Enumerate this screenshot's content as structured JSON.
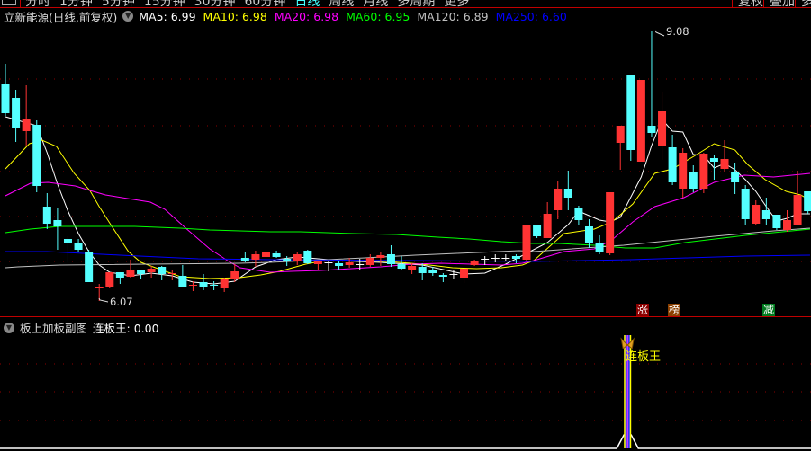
{
  "topbar": {
    "menu": [
      "分时",
      "1分钟",
      "5分钟",
      "15分钟",
      "30分钟",
      "60分钟",
      "日线",
      "周线",
      "月线",
      "多周期",
      "更多"
    ],
    "active": "日线",
    "right_buttons": [
      "复权",
      "叠加",
      "多"
    ]
  },
  "legend": {
    "title": "立新能源(日线,前复权)",
    "ma": [
      {
        "label": "MA5: 6.99",
        "color": "#ffffff"
      },
      {
        "label": "MA10: 6.98",
        "color": "#ffff00"
      },
      {
        "label": "MA20: 6.98",
        "color": "#ff00ff"
      },
      {
        "label": "MA60: 6.95",
        "color": "#00ff00"
      },
      {
        "label": "MA120: 6.89",
        "color": "#c0c0c0"
      },
      {
        "label": "MA250: 6.60",
        "color": "#0000ff"
      }
    ]
  },
  "annotations": {
    "high": "9.08",
    "low": "6.07"
  },
  "tags": [
    {
      "text": "涨",
      "color": "#8b0000"
    },
    {
      "text": "榜",
      "color": "#8b4000"
    },
    {
      "text": "减",
      "color": "#007a1f"
    }
  ],
  "sub": {
    "title": "板上加板副图",
    "indicator": "连板王: 0.00",
    "signal_label": "连板王"
  },
  "colors": {
    "up": "#ff3333",
    "down": "#54ffff",
    "grid": "#8b0000"
  },
  "chart_data": {
    "type": "candlestick",
    "ylim": [
      6.0,
      9.2
    ],
    "candles": [
      [
        8.49,
        8.16,
        8.71,
        8.13
      ],
      [
        8.33,
        7.99,
        8.42,
        7.84
      ],
      [
        7.96,
        8.09,
        8.47,
        7.79
      ],
      [
        8.03,
        7.35,
        8.08,
        7.28
      ],
      [
        7.12,
        6.93,
        7.27,
        6.87
      ],
      [
        6.97,
        6.9,
        7.1,
        6.64
      ],
      [
        6.76,
        6.71,
        6.79,
        6.5
      ],
      [
        6.71,
        6.64,
        6.76,
        6.61
      ],
      [
        6.61,
        6.28,
        6.64,
        6.28
      ],
      [
        6.21,
        6.23,
        6.26,
        6.07
      ],
      [
        6.23,
        6.39,
        6.39,
        6.21
      ],
      [
        6.39,
        6.33,
        6.39,
        6.26
      ],
      [
        6.34,
        6.42,
        6.53,
        6.33
      ],
      [
        6.41,
        6.37,
        6.41,
        6.31
      ],
      [
        6.39,
        6.43,
        6.46,
        6.33
      ],
      [
        6.45,
        6.37,
        6.46,
        6.3
      ],
      [
        6.37,
        6.38,
        6.42,
        6.3
      ],
      [
        6.35,
        6.23,
        6.47,
        6.22
      ],
      [
        6.24,
        6.25,
        6.29,
        6.18
      ],
      [
        6.28,
        6.22,
        6.37,
        6.19
      ],
      [
        6.25,
        6.24,
        6.29,
        6.19
      ],
      [
        6.21,
        6.31,
        6.33,
        6.17
      ],
      [
        6.31,
        6.4,
        6.48,
        6.28
      ],
      [
        6.55,
        6.51,
        6.61,
        6.5
      ],
      [
        6.53,
        6.59,
        6.63,
        6.45
      ],
      [
        6.56,
        6.62,
        6.66,
        6.54
      ],
      [
        6.6,
        6.56,
        6.63,
        6.55
      ],
      [
        6.54,
        6.51,
        6.57,
        6.46
      ],
      [
        6.52,
        6.59,
        6.61,
        6.47
      ],
      [
        6.63,
        6.49,
        6.64,
        6.48
      ],
      [
        6.48,
        6.51,
        6.52,
        6.42
      ],
      [
        6.5,
        6.5,
        6.52,
        6.4
      ],
      [
        6.49,
        6.46,
        6.51,
        6.42
      ],
      [
        6.47,
        6.5,
        6.55,
        6.44
      ],
      [
        6.48,
        6.48,
        6.54,
        6.42
      ],
      [
        6.47,
        6.55,
        6.59,
        6.45
      ],
      [
        6.55,
        6.58,
        6.62,
        6.46
      ],
      [
        6.59,
        6.48,
        6.69,
        6.45
      ],
      [
        6.48,
        6.43,
        6.57,
        6.41
      ],
      [
        6.41,
        6.46,
        6.49,
        6.37
      ],
      [
        6.45,
        6.38,
        6.49,
        6.3
      ],
      [
        6.42,
        6.38,
        6.45,
        6.35
      ],
      [
        6.36,
        6.34,
        6.38,
        6.28
      ],
      [
        6.37,
        6.37,
        6.42,
        6.31
      ],
      [
        6.33,
        6.43,
        6.45,
        6.27
      ],
      [
        6.47,
        6.51,
        6.53,
        6.46
      ],
      [
        6.54,
        6.54,
        6.57,
        6.47
      ],
      [
        6.55,
        6.55,
        6.59,
        6.5
      ],
      [
        6.55,
        6.55,
        6.59,
        6.51
      ],
      [
        6.57,
        6.54,
        6.59,
        6.49
      ],
      [
        6.53,
        6.91,
        6.92,
        6.52
      ],
      [
        6.91,
        6.79,
        6.92,
        6.77
      ],
      [
        6.77,
        7.04,
        7.17,
        6.77
      ],
      [
        7.08,
        7.32,
        7.4,
        6.98
      ],
      [
        7.32,
        7.22,
        7.52,
        7.08
      ],
      [
        7.11,
        6.97,
        7.13,
        6.92
      ],
      [
        6.9,
        6.72,
        6.98,
        6.66
      ],
      [
        6.71,
        6.61,
        6.8,
        6.59
      ],
      [
        6.6,
        7.28,
        7.28,
        6.58
      ],
      [
        7.83,
        8.02,
        8.02,
        7.53
      ],
      [
        8.58,
        7.75,
        8.58,
        7.63
      ],
      [
        7.62,
        8.53,
        8.53,
        7.62
      ],
      [
        8.02,
        7.94,
        9.08,
        7.9
      ],
      [
        7.79,
        8.18,
        8.4,
        7.64
      ],
      [
        7.78,
        7.39,
        7.92,
        7.36
      ],
      [
        7.32,
        7.72,
        7.77,
        7.22
      ],
      [
        7.51,
        7.32,
        7.58,
        7.28
      ],
      [
        7.32,
        7.71,
        7.72,
        7.27
      ],
      [
        7.66,
        7.62,
        7.69,
        7.42
      ],
      [
        7.54,
        7.65,
        7.86,
        7.5
      ],
      [
        7.5,
        7.39,
        7.61,
        7.26
      ],
      [
        7.32,
        6.98,
        7.36,
        6.91
      ],
      [
        6.93,
        7.14,
        7.19,
        6.92
      ],
      [
        7.08,
        6.98,
        7.22,
        6.92
      ],
      [
        7.03,
        6.88,
        7.03,
        6.86
      ],
      [
        6.86,
        6.97,
        7.08,
        6.84
      ],
      [
        6.92,
        7.25,
        7.52,
        6.92
      ],
      [
        7.29,
        7.07,
        7.29,
        7.04
      ]
    ],
    "ma_lines": [
      {
        "name": "MA5",
        "color": "#ffffff",
        "points": [
          [
            0,
            8.12
          ],
          [
            3,
            8.02
          ],
          [
            4,
            7.72
          ],
          [
            5,
            7.37
          ],
          [
            6,
            7.07
          ],
          [
            7,
            6.82
          ],
          [
            8,
            6.62
          ],
          [
            9,
            6.47
          ],
          [
            10,
            6.39
          ],
          [
            12,
            6.35
          ],
          [
            14,
            6.38
          ],
          [
            16,
            6.35
          ],
          [
            18,
            6.28
          ],
          [
            20,
            6.26
          ],
          [
            22,
            6.29
          ],
          [
            24,
            6.45
          ],
          [
            26,
            6.53
          ],
          [
            28,
            6.56
          ],
          [
            32,
            6.52
          ],
          [
            36,
            6.5
          ],
          [
            40,
            6.47
          ],
          [
            44,
            6.37
          ],
          [
            46,
            6.38
          ],
          [
            48,
            6.48
          ],
          [
            50,
            6.6
          ],
          [
            52,
            6.72
          ],
          [
            54,
            6.92
          ],
          [
            55,
            7.07
          ],
          [
            57,
            6.97
          ],
          [
            58,
            6.95
          ],
          [
            59,
            7.0
          ],
          [
            61,
            7.45
          ],
          [
            62,
            7.8
          ],
          [
            63,
            8.09
          ],
          [
            64,
            7.96
          ],
          [
            65,
            7.95
          ],
          [
            66,
            7.7
          ],
          [
            67,
            7.69
          ],
          [
            68,
            7.55
          ],
          [
            69,
            7.6
          ],
          [
            70,
            7.53
          ],
          [
            71,
            7.42
          ],
          [
            72,
            7.29
          ],
          [
            73,
            7.12
          ],
          [
            74,
            6.96
          ],
          [
            75,
            6.99
          ],
          [
            76,
            7.04
          ],
          [
            77.2,
            7.04
          ]
        ]
      },
      {
        "name": "MA10",
        "color": "#ffff00",
        "points": [
          [
            0,
            7.54
          ],
          [
            2.3,
            7.82
          ],
          [
            3.5,
            7.86
          ],
          [
            4.9,
            7.79
          ],
          [
            6.6,
            7.49
          ],
          [
            8.1,
            7.3
          ],
          [
            9,
            7.12
          ],
          [
            10.1,
            6.92
          ],
          [
            11.8,
            6.62
          ],
          [
            13,
            6.5
          ],
          [
            14.4,
            6.44
          ],
          [
            16.8,
            6.34
          ],
          [
            19.6,
            6.32
          ],
          [
            22.5,
            6.33
          ],
          [
            24.5,
            6.36
          ],
          [
            26.3,
            6.4
          ],
          [
            28.8,
            6.48
          ],
          [
            30.6,
            6.52
          ],
          [
            33.2,
            6.52
          ],
          [
            36.6,
            6.51
          ],
          [
            38.9,
            6.49
          ],
          [
            40.7,
            6.47
          ],
          [
            42.9,
            6.44
          ],
          [
            45.2,
            6.43
          ],
          [
            47.6,
            6.44
          ],
          [
            49.6,
            6.47
          ],
          [
            50.7,
            6.52
          ],
          [
            53.6,
            6.82
          ],
          [
            56.5,
            6.87
          ],
          [
            58.2,
            6.95
          ],
          [
            60.2,
            7.15
          ],
          [
            62.3,
            7.49
          ],
          [
            64,
            7.54
          ],
          [
            66.2,
            7.69
          ],
          [
            68,
            7.82
          ],
          [
            70,
            7.75
          ],
          [
            71.2,
            7.59
          ],
          [
            72.9,
            7.42
          ],
          [
            74.9,
            7.29
          ],
          [
            76.3,
            7.25
          ],
          [
            77.2,
            7.19
          ]
        ]
      },
      {
        "name": "MA20",
        "color": "#ff00ff",
        "points": [
          [
            0,
            7.24
          ],
          [
            2.4,
            7.38
          ],
          [
            4.1,
            7.39
          ],
          [
            6.7,
            7.35
          ],
          [
            8.1,
            7.3
          ],
          [
            9.6,
            7.25
          ],
          [
            13.9,
            7.17
          ],
          [
            15.3,
            7.09
          ],
          [
            17.4,
            6.87
          ],
          [
            19.6,
            6.65
          ],
          [
            21.3,
            6.52
          ],
          [
            22.5,
            6.44
          ],
          [
            25.4,
            6.39
          ],
          [
            27.4,
            6.4
          ],
          [
            30.3,
            6.41
          ],
          [
            33.2,
            6.43
          ],
          [
            36,
            6.45
          ],
          [
            39,
            6.48
          ],
          [
            41.8,
            6.49
          ],
          [
            44.7,
            6.48
          ],
          [
            47.6,
            6.47
          ],
          [
            49.6,
            6.49
          ],
          [
            50.7,
            6.52
          ],
          [
            53.6,
            6.62
          ],
          [
            56.5,
            6.65
          ],
          [
            58.2,
            6.75
          ],
          [
            60.2,
            6.95
          ],
          [
            62.3,
            7.12
          ],
          [
            65.1,
            7.22
          ],
          [
            68,
            7.39
          ],
          [
            70.9,
            7.47
          ],
          [
            73.7,
            7.45
          ],
          [
            77.2,
            7.49
          ]
        ]
      },
      {
        "name": "MA60",
        "color": "#00ff00",
        "points": [
          [
            0,
            6.83
          ],
          [
            2.4,
            6.87
          ],
          [
            5.2,
            6.9
          ],
          [
            12.4,
            6.9
          ],
          [
            16.8,
            6.88
          ],
          [
            19.6,
            6.86
          ],
          [
            25.4,
            6.84
          ],
          [
            28.3,
            6.84
          ],
          [
            33.5,
            6.82
          ],
          [
            37.5,
            6.81
          ],
          [
            41.5,
            6.78
          ],
          [
            44.5,
            6.76
          ],
          [
            47.6,
            6.73
          ],
          [
            50.5,
            6.71
          ],
          [
            53.1,
            6.71
          ],
          [
            56.5,
            6.69
          ],
          [
            59.5,
            6.66
          ],
          [
            62.3,
            6.66
          ],
          [
            65.2,
            6.72
          ],
          [
            71,
            6.8
          ],
          [
            77.2,
            6.87
          ]
        ]
      },
      {
        "name": "MA120",
        "color": "#c0c0c0",
        "points": [
          [
            0,
            6.44
          ],
          [
            1.2,
            6.45
          ],
          [
            5.2,
            6.47
          ],
          [
            22.5,
            6.49
          ],
          [
            25.4,
            6.5
          ],
          [
            34.5,
            6.55
          ],
          [
            39.3,
            6.58
          ],
          [
            43.3,
            6.6
          ],
          [
            49.3,
            6.63
          ],
          [
            50.7,
            6.62
          ],
          [
            59.3,
            6.69
          ],
          [
            68,
            6.79
          ],
          [
            73.7,
            6.85
          ],
          [
            77.2,
            6.88
          ]
        ]
      },
      {
        "name": "MA250",
        "color": "#0000ff",
        "points": [
          [
            0,
            6.62
          ],
          [
            4,
            6.62
          ],
          [
            11,
            6.58
          ],
          [
            18.5,
            6.54
          ],
          [
            25.4,
            6.53
          ],
          [
            50.7,
            6.51
          ],
          [
            60,
            6.53
          ],
          [
            65.5,
            6.55
          ],
          [
            71,
            6.57
          ],
          [
            77.2,
            6.58
          ]
        ]
      }
    ],
    "signal": {
      "index": 59,
      "value": 1
    }
  }
}
